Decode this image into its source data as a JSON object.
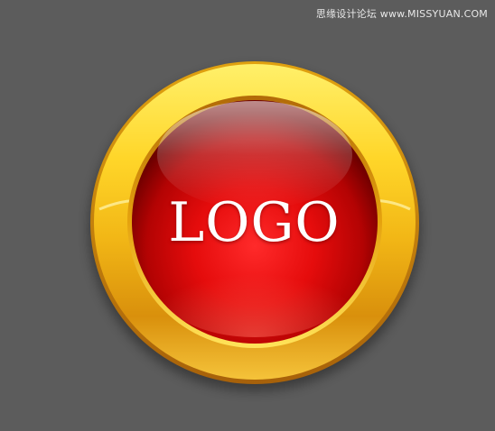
{
  "watermark": {
    "text": "思缘设计论坛  www.MISSYUAN.COM"
  },
  "logo": {
    "text": "LOGO"
  },
  "colors": {
    "background": "#5c5c5c",
    "gold_light": "#ffe24a",
    "gold_dark": "#c97e0a",
    "red_center": "#ff1a1a",
    "red_edge": "#7a0000",
    "text": "#ffffff"
  }
}
